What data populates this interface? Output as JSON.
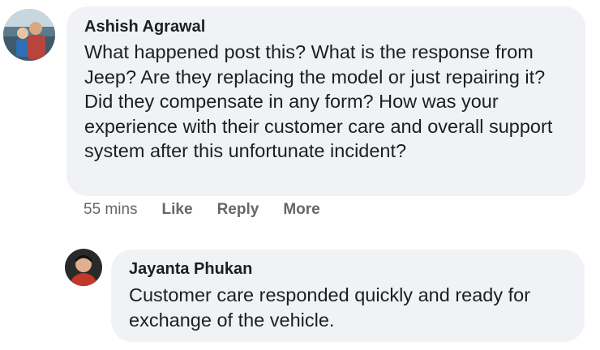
{
  "comments": [
    {
      "author": "Ashish Agrawal",
      "text": "What happened post this? What is the response from Jeep? Are they replacing the model or just repairing it? Did they compensate in any form? How was your experience with their customer care and overall support system after this unfortunate incident?",
      "time": "55 mins",
      "actions": [
        "Like",
        "Reply",
        "More"
      ]
    },
    {
      "author": "Jayanta Phukan",
      "text": "Customer care responded quickly and ready for exchange of the vehicle."
    }
  ],
  "colors": {
    "bubble": "#f0f2f5",
    "text": "#1c1e21",
    "meta": "#65676b"
  }
}
